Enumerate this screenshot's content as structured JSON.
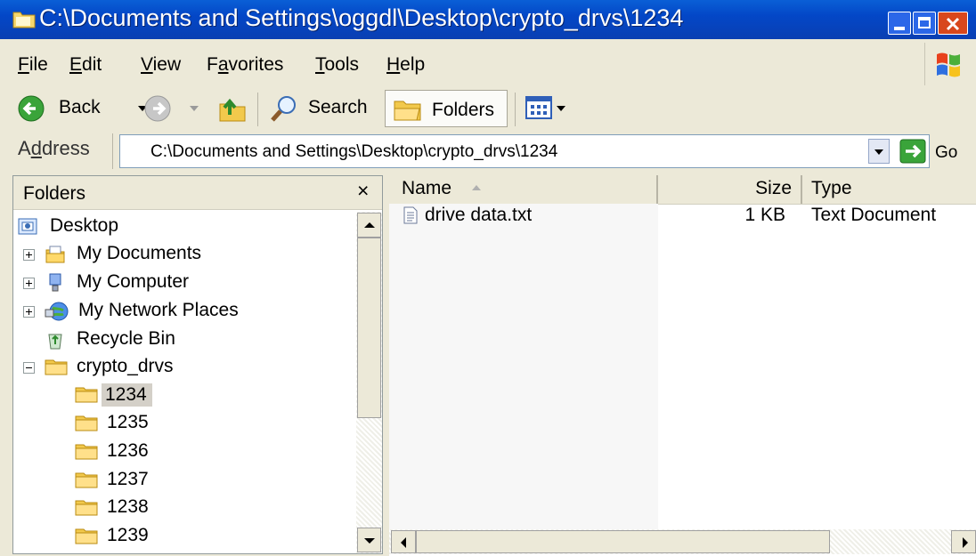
{
  "window": {
    "title": "C:\\Documents and Settings\\oggdl\\Desktop\\crypto_drvs\\1234",
    "min_label": "_",
    "max_label": "□",
    "close_label": "×"
  },
  "menu": {
    "file": {
      "u": "F",
      "rest": "ile"
    },
    "edit": {
      "u": "E",
      "rest": "dit"
    },
    "view": {
      "u": "V",
      "rest": "iew"
    },
    "favorites": {
      "pre": "F",
      "u": "a",
      "rest": "vorites"
    },
    "tools": {
      "u": "T",
      "rest": "ools"
    },
    "help": {
      "u": "H",
      "rest": "elp"
    }
  },
  "toolbar": {
    "back": "Back",
    "search": "Search",
    "folders": "Folders"
  },
  "address": {
    "label_pre": "A",
    "label_u": "d",
    "label_rest": "dress",
    "value": "C:\\Documents and Settings\\Desktop\\crypto_drvs\\1234",
    "go": "Go"
  },
  "folders_pane": {
    "title": "Folders",
    "close": "×",
    "items": [
      {
        "label": "Desktop",
        "icon": "desktop-icon"
      },
      {
        "label": "My Documents",
        "icon": "my-documents-icon",
        "expander": "+"
      },
      {
        "label": "My Computer",
        "icon": "my-computer-icon",
        "expander": "+"
      },
      {
        "label": "My Network Places",
        "icon": "network-places-icon",
        "expander": "+"
      },
      {
        "label": "Recycle Bin",
        "icon": "recycle-bin-icon"
      },
      {
        "label": "crypto_drvs",
        "icon": "folder-icon",
        "expander": "−"
      },
      {
        "label": "1234",
        "icon": "folder-icon",
        "selected": true
      },
      {
        "label": "1235",
        "icon": "folder-icon"
      },
      {
        "label": "1236",
        "icon": "folder-icon"
      },
      {
        "label": "1237",
        "icon": "folder-icon"
      },
      {
        "label": "1238",
        "icon": "folder-icon"
      },
      {
        "label": "1239",
        "icon": "folder-icon"
      }
    ]
  },
  "file_list": {
    "columns": {
      "name": "Name",
      "size": "Size",
      "type": "Type"
    },
    "rows": [
      {
        "name": "drive data.txt",
        "size": "1 KB",
        "type": "Text Document",
        "icon": "text-file-icon"
      }
    ]
  },
  "colors": {
    "titlebar": "#0a4fcf",
    "selection": "#d4d0c8",
    "folder": "#f2c94c"
  }
}
